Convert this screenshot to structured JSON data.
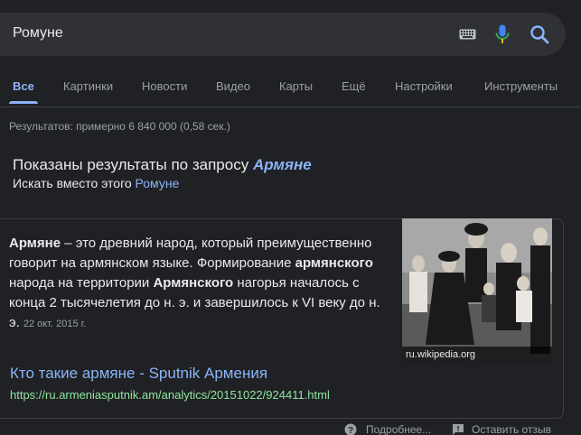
{
  "search": {
    "query": "Ромуне"
  },
  "icons": {
    "keyboard": "keyboard-icon",
    "mic": "mic-icon",
    "search": "search-icon"
  },
  "colors": {
    "background": "#202124",
    "link": "#8ab4f8",
    "url": "#8ee4a0",
    "mic_red": "#ea4335",
    "mic_yellow": "#fbbc04",
    "mic_blue": "#4285f4"
  },
  "tabs": [
    {
      "label": "Все",
      "active": true
    },
    {
      "label": "Картинки"
    },
    {
      "label": "Новости"
    },
    {
      "label": "Видео"
    },
    {
      "label": "Карты"
    },
    {
      "label": "Ещё"
    },
    {
      "label": "Настройки"
    },
    {
      "label": "Инструменты"
    }
  ],
  "stats": "Результатов: примерно 6 840 000 (0,58 сек.)",
  "spelling": {
    "shown_prefix": "Показаны результаты по запросу",
    "corrected": "Армяне",
    "instead_prefix": "Искать вместо этого",
    "original": "Ромуне"
  },
  "snippet": {
    "b1": "Армяне",
    "t1": " – это древний народ, который преимущественно говорит на армянском языке. Формирование ",
    "b2": "армянского",
    "t2": " народа на территории ",
    "b3": "Армянского",
    "t3": " нагорья началось с конца 2 тысячелетия до н. э. и завершилось к VI веку до н. э.",
    "date": "22 окт. 2015 г.",
    "image_caption": "ru.wikipedia.org"
  },
  "result": {
    "title": "Кто такие армяне - Sputnik Армения",
    "url": "https://ru.armeniasputnik.am/analytics/20151022/924411.html"
  },
  "footer": {
    "more": "Подробнее...",
    "feedback": "Оставить отзыв"
  }
}
